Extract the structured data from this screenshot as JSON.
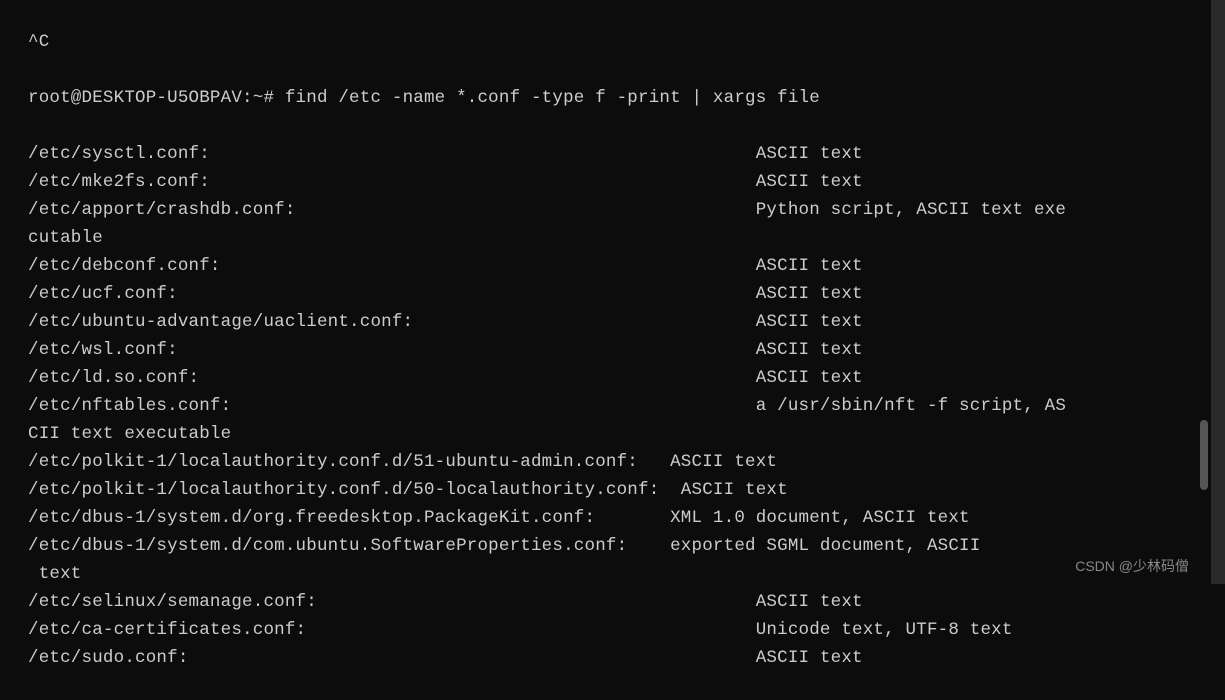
{
  "interrupt": "^C",
  "prompt": "root@DESKTOP-U5OBPAV:~#",
  "command": "find /etc -name *.conf -type f -print | xargs file",
  "lines": [
    {
      "path": "/etc/sysctl.conf:",
      "desc": "ASCII text",
      "col": 67
    },
    {
      "path": "/etc/mke2fs.conf:",
      "desc": "ASCII text",
      "col": 67
    },
    {
      "path": "/etc/apport/crashdb.conf:",
      "desc": "Python script, ASCII text exe",
      "col": 67,
      "wrap": "cutable"
    },
    {
      "path": "/etc/debconf.conf:",
      "desc": "ASCII text",
      "col": 67
    },
    {
      "path": "/etc/ucf.conf:",
      "desc": "ASCII text",
      "col": 67
    },
    {
      "path": "/etc/ubuntu-advantage/uaclient.conf:",
      "desc": "ASCII text",
      "col": 67
    },
    {
      "path": "/etc/wsl.conf:",
      "desc": "ASCII text",
      "col": 67
    },
    {
      "path": "/etc/ld.so.conf:",
      "desc": "ASCII text",
      "col": 67
    },
    {
      "path": "/etc/nftables.conf:",
      "desc": "a /usr/sbin/nft -f script, AS",
      "col": 67,
      "wrap": "CII text executable"
    },
    {
      "path": "/etc/polkit-1/localauthority.conf.d/51-ubuntu-admin.conf:",
      "desc": "ASCII text",
      "col": 59
    },
    {
      "path": "/etc/polkit-1/localauthority.conf.d/50-localauthority.conf:",
      "desc": "ASCII text",
      "col": 60
    },
    {
      "path": "/etc/dbus-1/system.d/org.freedesktop.PackageKit.conf:",
      "desc": "XML 1.0 document, ASCII text",
      "col": 59
    },
    {
      "path": "/etc/dbus-1/system.d/com.ubuntu.SoftwareProperties.conf:",
      "desc": "exported SGML document, ASCII",
      "col": 59,
      "wrap": " text"
    },
    {
      "path": "/etc/selinux/semanage.conf:",
      "desc": "ASCII text",
      "col": 67
    },
    {
      "path": "/etc/ca-certificates.conf:",
      "desc": "Unicode text, UTF-8 text",
      "col": 67
    },
    {
      "path": "/etc/sudo.conf:",
      "desc": "ASCII text",
      "col": 67
    }
  ],
  "watermark": "CSDN @少林码僧"
}
